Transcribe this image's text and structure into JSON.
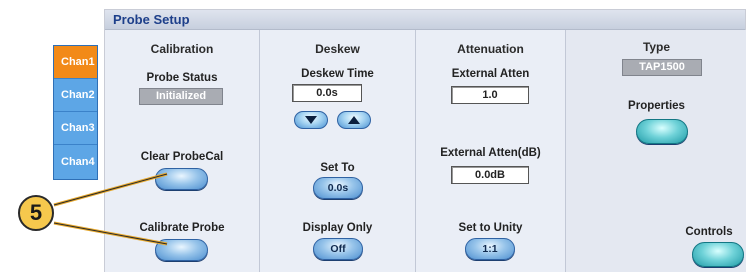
{
  "window": {
    "title": "Probe Setup"
  },
  "channels": [
    "Chan1",
    "Chan2",
    "Chan3",
    "Chan4"
  ],
  "active_channel": "Chan1",
  "calibration": {
    "title": "Calibration",
    "probe_status_label": "Probe Status",
    "probe_status_value": "Initialized",
    "clear_probecal_label": "Clear ProbeCal",
    "calibrate_probe_label": "Calibrate Probe"
  },
  "deskew": {
    "title": "Deskew",
    "deskew_time_label": "Deskew Time",
    "deskew_time_value": "0.0s",
    "set_to_label": "Set To",
    "set_to_value": "0.0s",
    "display_only_label": "Display Only",
    "display_only_value": "Off"
  },
  "attenuation": {
    "title": "Attenuation",
    "external_atten_label": "External Atten",
    "external_atten_value": "1.0",
    "external_atten_db_label": "External Atten(dB)",
    "external_atten_db_value": "0.0dB",
    "set_to_unity_label": "Set to Unity",
    "set_to_unity_value": "1:1"
  },
  "type": {
    "title": "Type",
    "probe_type_value": "TAP1500",
    "properties_label": "Properties",
    "controls_label": "Controls"
  },
  "callout": {
    "number": "5"
  },
  "colors": {
    "accent_blue": "#1d3f8a",
    "active_tab": "#f28a18",
    "tab_blue": "#5da6e6",
    "callout": "#f6c84d"
  }
}
